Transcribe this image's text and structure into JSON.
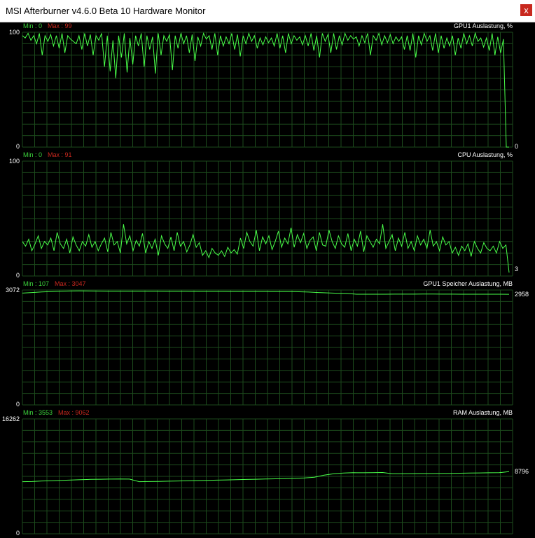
{
  "window": {
    "title": "MSI Afterburner v4.6.0 Beta 10 Hardware Monitor",
    "close_label": "x"
  },
  "colors": {
    "line": "#49ff49",
    "grid": "#1c4a1c",
    "min": "#3cd43c",
    "max": "#c8281e"
  },
  "graphs": [
    {
      "name": "GPU1 Auslastung, %",
      "min_label": "Min : 0",
      "max_label": "Max : 99",
      "y_top": "100",
      "y_bottom": "0",
      "current": "0",
      "ymax": 100,
      "values": [
        97,
        95,
        99,
        93,
        97,
        90,
        99,
        80,
        97,
        92,
        98,
        88,
        97,
        86,
        99,
        82,
        97,
        94,
        92,
        90,
        97,
        85,
        99,
        88,
        98,
        80,
        97,
        93,
        99,
        70,
        97,
        66,
        93,
        60,
        97,
        78,
        99,
        65,
        95,
        72,
        97,
        88,
        99,
        70,
        97,
        85,
        96,
        64,
        99,
        80,
        97,
        92,
        98,
        67,
        97,
        86,
        99,
        90,
        97,
        82,
        98,
        75,
        96,
        88,
        99,
        94,
        97,
        85,
        99,
        80,
        97,
        88,
        96,
        90,
        99,
        85,
        98,
        79,
        97,
        90,
        99,
        92,
        97,
        86,
        95,
        89,
        96,
        91,
        95,
        88,
        99,
        86,
        97,
        82,
        99,
        90,
        97,
        93,
        96,
        89,
        97,
        88,
        99,
        84,
        97,
        78,
        99,
        92,
        98,
        82,
        99,
        85,
        97,
        89,
        99,
        93,
        97,
        94,
        96,
        88,
        97,
        91,
        99,
        80,
        97,
        93,
        99,
        89,
        97,
        91,
        98,
        90,
        96,
        92,
        96,
        85,
        97,
        84,
        99,
        78,
        97,
        89,
        99,
        92,
        97,
        84,
        99,
        82,
        97,
        86,
        95,
        88,
        97,
        80,
        95,
        86,
        99,
        90,
        97,
        88,
        99,
        92,
        95,
        87,
        95,
        84,
        99,
        80,
        96,
        82,
        94,
        0,
        0
      ],
      "series_name": ""
    },
    {
      "name": "CPU Auslastung, %",
      "min_label": "Min : 0",
      "max_label": "Max : 91",
      "y_top": "100",
      "y_bottom": "0",
      "current": "3",
      "ymax": 100,
      "values": [
        30,
        26,
        32,
        22,
        28,
        35,
        24,
        30,
        27,
        33,
        22,
        38,
        28,
        24,
        32,
        20,
        34,
        27,
        22,
        30,
        26,
        36,
        25,
        30,
        22,
        28,
        33,
        21,
        38,
        27,
        30,
        20,
        45,
        28,
        35,
        22,
        31,
        26,
        37,
        20,
        30,
        24,
        32,
        18,
        35,
        28,
        24,
        34,
        22,
        38,
        26,
        30,
        21,
        27,
        36,
        25,
        29,
        18,
        22,
        16,
        24,
        20,
        18,
        22,
        17,
        25,
        20,
        23,
        19,
        33,
        24,
        38,
        30,
        26,
        40,
        22,
        34,
        28,
        35,
        23,
        30,
        39,
        25,
        33,
        28,
        42,
        25,
        36,
        29,
        37,
        24,
        31,
        34,
        22,
        38,
        27,
        26,
        40,
        30,
        24,
        35,
        28,
        25,
        37,
        22,
        32,
        26,
        39,
        21,
        35,
        30,
        25,
        32,
        28,
        45,
        24,
        30,
        36,
        22,
        33,
        26,
        38,
        24,
        30,
        22,
        35,
        27,
        32,
        24,
        40,
        26,
        30,
        22,
        34,
        27,
        30,
        20,
        25,
        18,
        26,
        22,
        28,
        17,
        30,
        24,
        20,
        29,
        24,
        22,
        26,
        20,
        30,
        24,
        27,
        3
      ],
      "series_name": ""
    },
    {
      "name": "GPU1 Speicher Auslastung, MB",
      "min_label": "Min : 107",
      "max_label": "Max : 3047",
      "y_top": "3072",
      "y_bottom": "0",
      "current": "2958",
      "ymax": 3072,
      "values": [
        2990,
        3005,
        3020,
        3030,
        3040,
        3045,
        3047,
        3045,
        3043,
        3041,
        3040,
        3040,
        3039,
        3038,
        3038,
        3037,
        3036,
        3036,
        3035,
        3035,
        3034,
        3034,
        3033,
        3033,
        3032,
        3032,
        3031,
        3030,
        3030,
        3025,
        3018,
        3005,
        2995,
        2985,
        2980,
        2960,
        2960,
        2960,
        2960,
        2961,
        2962,
        2962,
        2963,
        2963,
        2962,
        2961,
        2960,
        2960,
        2960,
        2960,
        2959,
        2958
      ],
      "series_name": ""
    },
    {
      "name": "RAM Auslastung, MB",
      "min_label": "Min : 3553",
      "max_label": "Max : 9062",
      "y_top": "16262",
      "y_bottom": "0",
      "current": "8796",
      "ymax": 16262,
      "values": [
        7380,
        7400,
        7480,
        7520,
        7560,
        7620,
        7660,
        7700,
        7720,
        7740,
        7760,
        7740,
        7380,
        7400,
        7420,
        7450,
        7480,
        7510,
        7540,
        7570,
        7600,
        7630,
        7660,
        7690,
        7720,
        7750,
        7780,
        7810,
        7850,
        7900,
        8000,
        8300,
        8500,
        8600,
        8650,
        8640,
        8660,
        8680,
        8500,
        8510,
        8520,
        8525,
        8530,
        8540,
        8560,
        8580,
        8600,
        8620,
        8640,
        8660,
        8796
      ],
      "series_name": ""
    }
  ]
}
